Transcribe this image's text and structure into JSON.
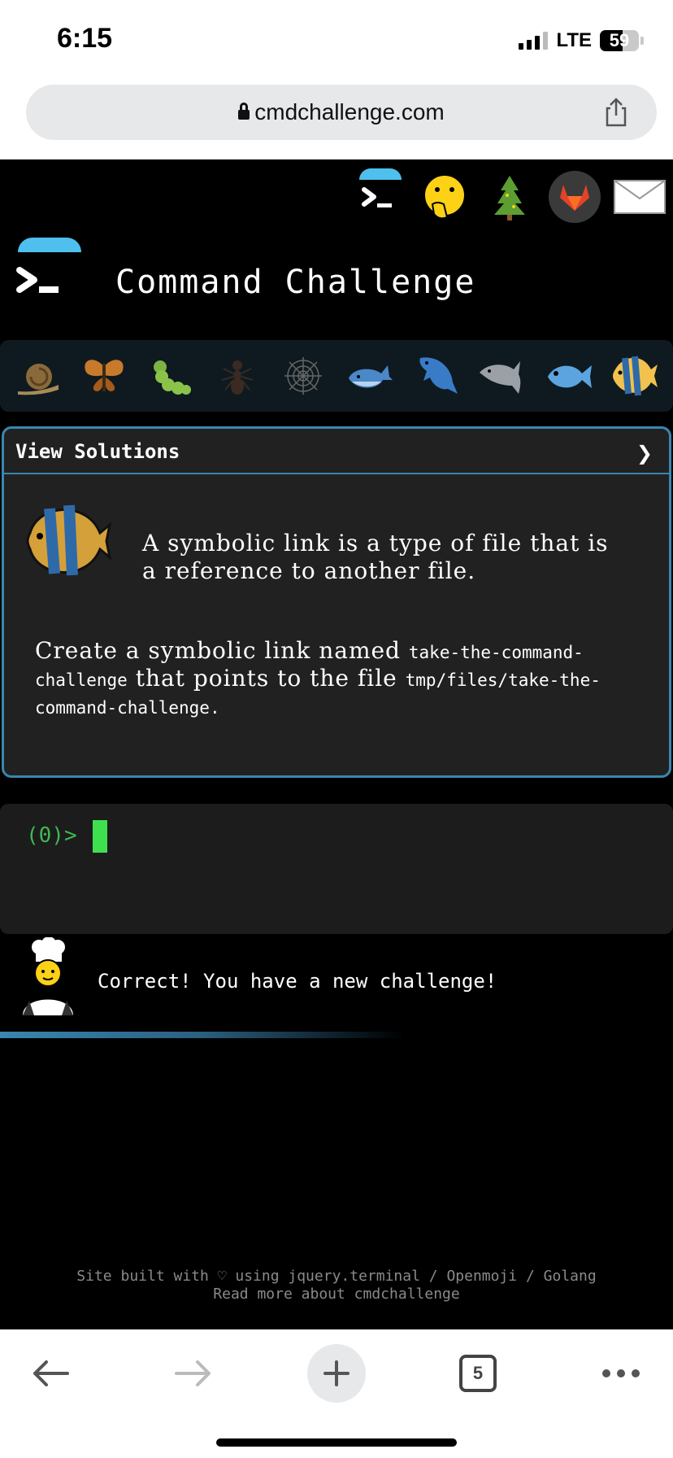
{
  "status_bar": {
    "time": "6:15",
    "network": "LTE",
    "battery": "59",
    "battery_fraction": 0.59
  },
  "browser": {
    "url": "cmdchallenge.com",
    "tab_count": "5"
  },
  "header": {
    "title": "Command Challenge",
    "icons": [
      "terminal-icon",
      "face-with-hand-over-mouth-icon",
      "tree-icon",
      "gitlab-icon",
      "mail-icon"
    ]
  },
  "levels": [
    "snail-icon",
    "butterfly-icon",
    "caterpillar-icon",
    "ant-icon",
    "spider-web-icon",
    "whale-icon",
    "dolphin-blue-icon",
    "dolphin-gray-icon",
    "fish-icon",
    "tropical-fish-icon"
  ],
  "solutions_panel": {
    "header_label": "View Solutions",
    "chevron": "❯",
    "description": "A symbolic link is a type of file that is a reference to another file.",
    "task_part1": "Create a symbolic link named",
    "task_code1": "take-the-command-challenge",
    "task_part2": "that points to the file",
    "task_code2": "tmp/files/take-the-command-challenge",
    "task_end": "."
  },
  "terminal": {
    "prompt": "(0)>"
  },
  "feedback": {
    "message": "Correct! You have a new challenge!"
  },
  "progress": {
    "fraction": 0.6
  },
  "footer": {
    "line1": "Site built with ♡ using jquery.terminal / Openmoji / Golang",
    "line2": "Read more about cmdchallenge"
  },
  "colors": {
    "accent": "#3a86b0",
    "terminal_green": "#3fe050",
    "dome_blue": "#4fbfee"
  }
}
